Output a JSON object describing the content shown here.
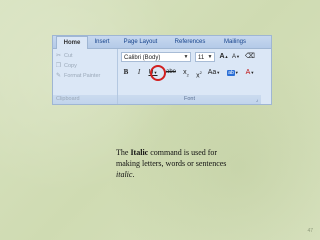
{
  "ribbon": {
    "tabs": [
      {
        "label": "Home",
        "active": true
      },
      {
        "label": "Insert",
        "active": false
      },
      {
        "label": "Page Layout",
        "active": false
      },
      {
        "label": "References",
        "active": false
      },
      {
        "label": "Mailings",
        "active": false
      }
    ],
    "clipboard": {
      "cut_label": "Cut",
      "copy_label": "Copy",
      "format_painter_label": "Format Painter",
      "group_label": "Clipboard"
    },
    "font": {
      "font_name": "Calibri (Body)",
      "font_size": "11",
      "grow_label": "A",
      "shrink_label": "A",
      "clear_format_label": "",
      "bold_label": "B",
      "italic_label": "I",
      "underline_label": "U",
      "strikethrough_label": "abe",
      "subscript_label": "x",
      "superscript_label": "x",
      "change_case_label": "Aa",
      "highlight_label": "ab",
      "font_color_label": "A",
      "group_label": "Font",
      "icons": {
        "cut": "scissors-icon",
        "copy": "copy-icon",
        "format_painter": "paintbrush-icon",
        "launcher": "dialog-launcher-icon"
      }
    },
    "colors": {
      "highlight_annotation": "#d21f1f",
      "ribbon_bg": "#dbe7f6",
      "tab_text": "#15428b"
    }
  },
  "caption": {
    "pre": "The ",
    "bold": "Italic",
    "mid": " command is used for making letters, words or sentences ",
    "italic": "italic",
    "end": "."
  },
  "page_number": "47"
}
